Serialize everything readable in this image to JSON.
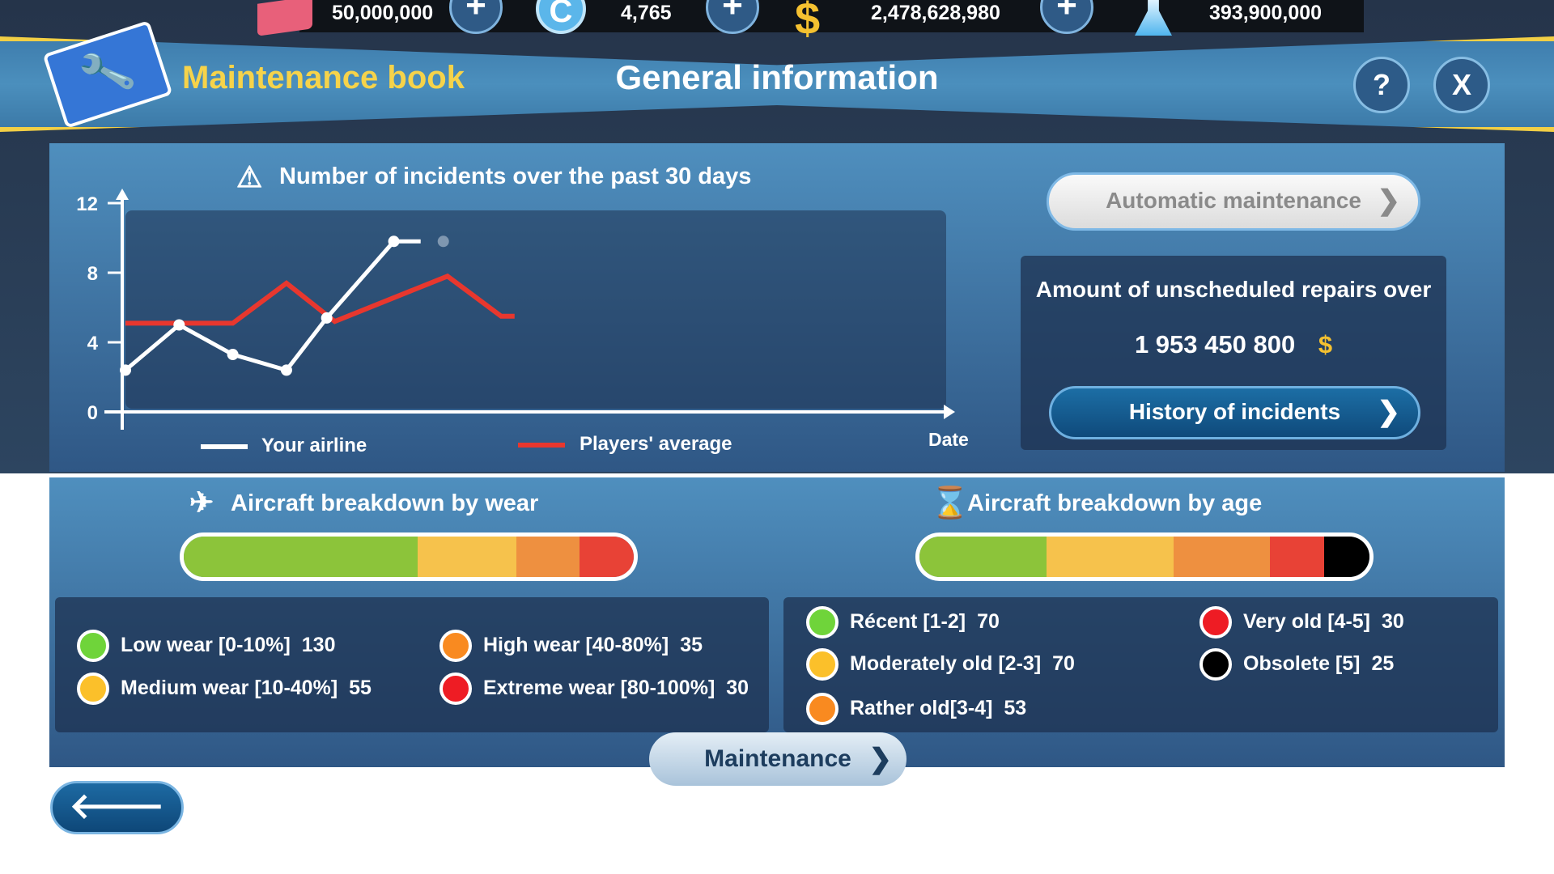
{
  "resources": [
    {
      "icon": "gift-card-icon",
      "value": "50,000,000",
      "color": "#e8607a"
    },
    {
      "icon": "coin-c-icon",
      "value": "4,765",
      "color": "#5bb6ea"
    },
    {
      "icon": "dollar-icon",
      "value": "2,478,628,980",
      "color": "#f5c130"
    },
    {
      "icon": "flask-icon",
      "value": "393,900,000",
      "color": "#8fd0f5"
    }
  ],
  "header": {
    "section": "Maintenance book",
    "title": "General information",
    "help": "?",
    "close": "X"
  },
  "chart_data": {
    "type": "line",
    "title": "Number of incidents over the past 30 days",
    "xlabel": "Date",
    "ylabel": "",
    "ylim": [
      0,
      12
    ],
    "yticks": [
      0,
      4,
      8,
      12
    ],
    "grid": false,
    "legend": "bottom",
    "series": [
      {
        "name": "Your airline",
        "color": "#ffffff",
        "x": [
          0,
          2,
          4,
          6,
          7.5,
          10,
          11
        ],
        "values": [
          2.4,
          5.0,
          3.3,
          2.4,
          5.4,
          9.8,
          9.8
        ]
      },
      {
        "name": "Players' average",
        "color": "#e8372e",
        "x": [
          0,
          4,
          6,
          7.8,
          12,
          14,
          14.5
        ],
        "values": [
          5.1,
          5.1,
          7.4,
          5.2,
          7.8,
          5.5,
          5.5
        ]
      }
    ]
  },
  "right": {
    "auto_maintenance": "Automatic maintenance",
    "repairs_label": "Amount of unscheduled repairs over",
    "repairs_amount": "1 953 450 800",
    "currency": "$",
    "history": "History of incidents"
  },
  "wear": {
    "title": "Aircraft breakdown by wear",
    "items": [
      {
        "label": "Low wear [0-10%]",
        "count": 130,
        "color": "#8cc43a",
        "dot": "#6fd43a"
      },
      {
        "label": "Medium wear [10-40%]",
        "count": 55,
        "color": "#f6c24c",
        "dot": "#fbc02a"
      },
      {
        "label": "High wear [40-80%]",
        "count": 35,
        "color": "#ee9040",
        "dot": "#f98a20"
      },
      {
        "label": "Extreme wear [80-100%]",
        "count": 30,
        "color": "#e84236",
        "dot": "#ee1c24"
      }
    ]
  },
  "age": {
    "title": "Aircraft breakdown by age",
    "items": [
      {
        "label": "Récent [1-2]",
        "count": 70,
        "color": "#8cc43a",
        "dot": "#6fd43a"
      },
      {
        "label": "Moderately old [2-3]",
        "count": 70,
        "color": "#f6c24c",
        "dot": "#fbc02a"
      },
      {
        "label": "Rather old[3-4]",
        "count": 53,
        "color": "#ee9040",
        "dot": "#f98a20"
      },
      {
        "label": "Very old [4-5]",
        "count": 30,
        "color": "#e84236",
        "dot": "#ee1c24"
      },
      {
        "label": "Obsolete [5]",
        "count": 25,
        "color": "#000000",
        "dot": "#000000"
      }
    ]
  },
  "footer": {
    "maintenance": "Maintenance"
  }
}
